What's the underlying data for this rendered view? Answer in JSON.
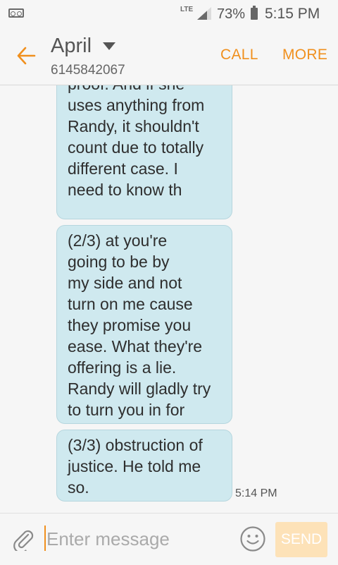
{
  "status_bar": {
    "network": "LTE",
    "battery": "73%",
    "time": "5:15 PM",
    "icons": [
      "voicemail-icon",
      "signal-icon",
      "battery-icon"
    ]
  },
  "header": {
    "contact_name": "April",
    "contact_number": "6145842067",
    "call_label": "CALL",
    "more_label": "MORE",
    "accent_color": "#f0901e"
  },
  "messages": [
    {
      "text": "proof. And if she\nuses anything from\nRandy, it shouldn't\ncount due to totally\ndifferent case. I\nneed to know th"
    },
    {
      "text": "(2/3) at you're\ngoing to be by\nmy side and not\nturn on me cause\nthey promise you\nease. What they're\noffering is a lie.\nRandy will gladly try\nto turn you in for"
    },
    {
      "text": "(3/3) obstruction of\njustice. He told me\nso.",
      "time": "5:14 PM"
    }
  ],
  "composer": {
    "placeholder": "Enter message",
    "send_label": "SEND",
    "bubble_color": "#cfe9ef"
  }
}
